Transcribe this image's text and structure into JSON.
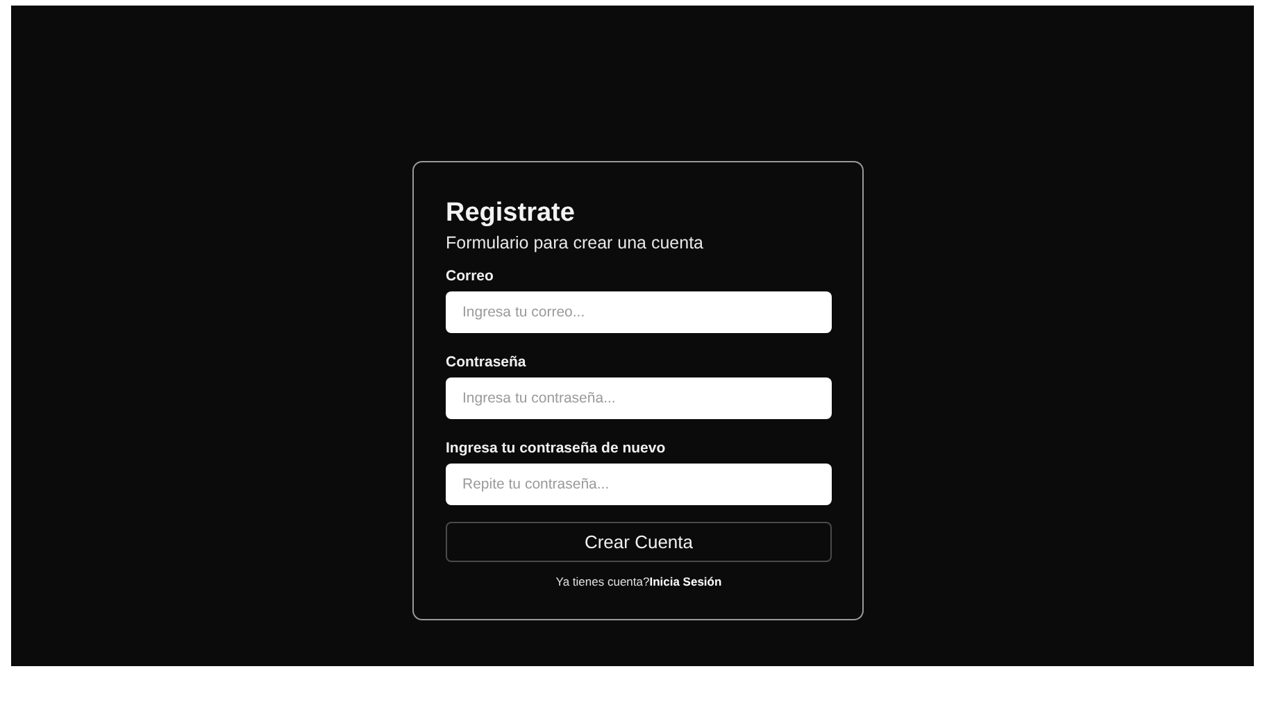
{
  "form": {
    "title": "Registrate",
    "subtitle": "Formulario para crear una cuenta",
    "fields": [
      {
        "label": "Correo",
        "placeholder": "Ingresa tu correo..."
      },
      {
        "label": "Contraseña",
        "placeholder": "Ingresa tu contraseña..."
      },
      {
        "label": "Ingresa tu contraseña de nuevo",
        "placeholder": "Repite tu contraseña..."
      }
    ],
    "submit": "Crear Cuenta",
    "footer": {
      "text": "Ya tienes cuenta?",
      "link": "Inicia Sesión"
    }
  }
}
